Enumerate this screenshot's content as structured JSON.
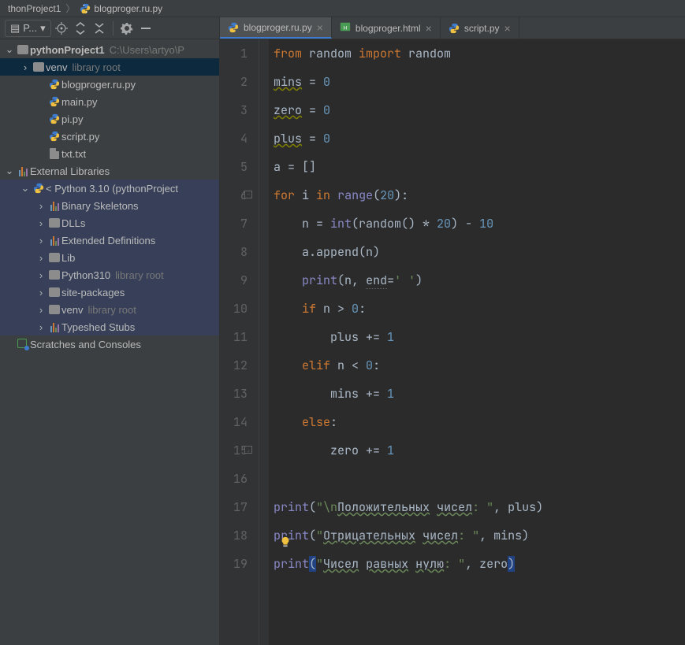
{
  "breadcrumb": {
    "project": "thonProject1",
    "file": "blogproger.ru.py"
  },
  "toolbar": {
    "project_selector": "P..."
  },
  "tree": {
    "root": {
      "label": "pythonProject1",
      "hint": "C:\\Users\\artyo\\P"
    },
    "venv": {
      "label": "venv",
      "hint": "library root"
    },
    "files": [
      {
        "label": "blogproger.ru.py"
      },
      {
        "label": "main.py"
      },
      {
        "label": "pi.py"
      },
      {
        "label": "script.py"
      },
      {
        "label": "txt.txt"
      }
    ],
    "external": {
      "label": "External Libraries"
    },
    "python_env": {
      "label": "< Python 3.10 (pythonProject"
    },
    "libs": [
      {
        "label": "Binary Skeletons",
        "icon": "lib"
      },
      {
        "label": "DLLs",
        "icon": "folder"
      },
      {
        "label": "Extended Definitions",
        "icon": "lib"
      },
      {
        "label": "Lib",
        "icon": "folder"
      },
      {
        "label": "Python310",
        "icon": "folder",
        "hint": "library root"
      },
      {
        "label": "site-packages",
        "icon": "folder"
      },
      {
        "label": "venv",
        "icon": "folder",
        "hint": "library root"
      },
      {
        "label": "Typeshed Stubs",
        "icon": "lib"
      }
    ],
    "scratches": {
      "label": "Scratches and Consoles"
    }
  },
  "tabs": [
    {
      "label": "blogproger.ru.py",
      "type": "py",
      "active": true
    },
    {
      "label": "blogproger.html",
      "type": "html",
      "active": false
    },
    {
      "label": "script.py",
      "type": "py",
      "active": false
    }
  ],
  "code": {
    "lines": [
      {
        "n": 1,
        "tokens": [
          [
            "kw",
            "from"
          ],
          [
            "op",
            " random "
          ],
          [
            "kw",
            "import"
          ],
          [
            "op",
            " random"
          ]
        ]
      },
      {
        "n": 2,
        "tokens": [
          [
            "warn",
            "mins"
          ],
          [
            "op",
            " = "
          ],
          [
            "num",
            "0"
          ]
        ]
      },
      {
        "n": 3,
        "tokens": [
          [
            "warn",
            "zero"
          ],
          [
            "op",
            " = "
          ],
          [
            "num",
            "0"
          ]
        ]
      },
      {
        "n": 4,
        "tokens": [
          [
            "warn",
            "plus"
          ],
          [
            "op",
            " = "
          ],
          [
            "num",
            "0"
          ]
        ]
      },
      {
        "n": 5,
        "tokens": [
          [
            "op",
            "a = []"
          ]
        ]
      },
      {
        "n": 6,
        "fold": true,
        "tokens": [
          [
            "kw",
            "for"
          ],
          [
            "op",
            " i "
          ],
          [
            "kw",
            "in"
          ],
          [
            "op",
            " "
          ],
          [
            "builtin",
            "range"
          ],
          [
            "op",
            "("
          ],
          [
            "num",
            "20"
          ],
          [
            "op",
            "):"
          ]
        ]
      },
      {
        "n": 7,
        "tokens": [
          [
            "op",
            "    n = "
          ],
          [
            "builtin",
            "int"
          ],
          [
            "op",
            "(random() * "
          ],
          [
            "num",
            "20"
          ],
          [
            "op",
            ") - "
          ],
          [
            "num",
            "10"
          ]
        ]
      },
      {
        "n": 8,
        "tokens": [
          [
            "op",
            "    a.append(n)"
          ]
        ]
      },
      {
        "n": 9,
        "tokens": [
          [
            "op",
            "    "
          ],
          [
            "builtin",
            "print"
          ],
          [
            "op",
            "(n"
          ],
          [
            "op",
            ", "
          ],
          [
            "info",
            "end"
          ],
          [
            "op",
            "="
          ],
          [
            "str",
            "' '"
          ],
          [
            "op",
            ")"
          ]
        ]
      },
      {
        "n": 10,
        "tokens": [
          [
            "op",
            "    "
          ],
          [
            "kw",
            "if"
          ],
          [
            "op",
            " n > "
          ],
          [
            "num",
            "0"
          ],
          [
            "op",
            ":"
          ]
        ]
      },
      {
        "n": 11,
        "tokens": [
          [
            "op",
            "        plus += "
          ],
          [
            "num",
            "1"
          ]
        ]
      },
      {
        "n": 12,
        "tokens": [
          [
            "op",
            "    "
          ],
          [
            "kw",
            "elif"
          ],
          [
            "op",
            " n < "
          ],
          [
            "num",
            "0"
          ],
          [
            "op",
            ":"
          ]
        ]
      },
      {
        "n": 13,
        "tokens": [
          [
            "op",
            "        mins += "
          ],
          [
            "num",
            "1"
          ]
        ]
      },
      {
        "n": 14,
        "tokens": [
          [
            "op",
            "    "
          ],
          [
            "kw",
            "else"
          ],
          [
            "op",
            ":"
          ]
        ]
      },
      {
        "n": 15,
        "foldend": true,
        "tokens": [
          [
            "op",
            "        zero += "
          ],
          [
            "num",
            "1"
          ]
        ]
      },
      {
        "n": 16,
        "tokens": []
      },
      {
        "n": 17,
        "tokens": [
          [
            "builtin",
            "print"
          ],
          [
            "op",
            "("
          ],
          [
            "str",
            "\"\\n"
          ],
          [
            "typo",
            "Положительных"
          ],
          [
            "str",
            " "
          ],
          [
            "typo",
            "чисел"
          ],
          [
            "str",
            ": \""
          ],
          [
            "op",
            ", plus)"
          ]
        ]
      },
      {
        "n": 18,
        "bulb": true,
        "tokens": [
          [
            "builtin",
            "print"
          ],
          [
            "op",
            "("
          ],
          [
            "str",
            "\""
          ],
          [
            "typo",
            "Отрицательных"
          ],
          [
            "str",
            " "
          ],
          [
            "typo",
            "чисел"
          ],
          [
            "str",
            ": \""
          ],
          [
            "op",
            ", mins)"
          ]
        ]
      },
      {
        "n": 19,
        "tokens": [
          [
            "builtin",
            "print"
          ],
          [
            "cursor-block",
            "("
          ],
          [
            "str",
            "\""
          ],
          [
            "typo",
            "Чисел"
          ],
          [
            "str",
            " "
          ],
          [
            "typo",
            "равных"
          ],
          [
            "str",
            " "
          ],
          [
            "typo",
            "нулю"
          ],
          [
            "str",
            ": \""
          ],
          [
            "op",
            ", zero"
          ],
          [
            "cursor-block",
            ")"
          ]
        ]
      }
    ]
  }
}
